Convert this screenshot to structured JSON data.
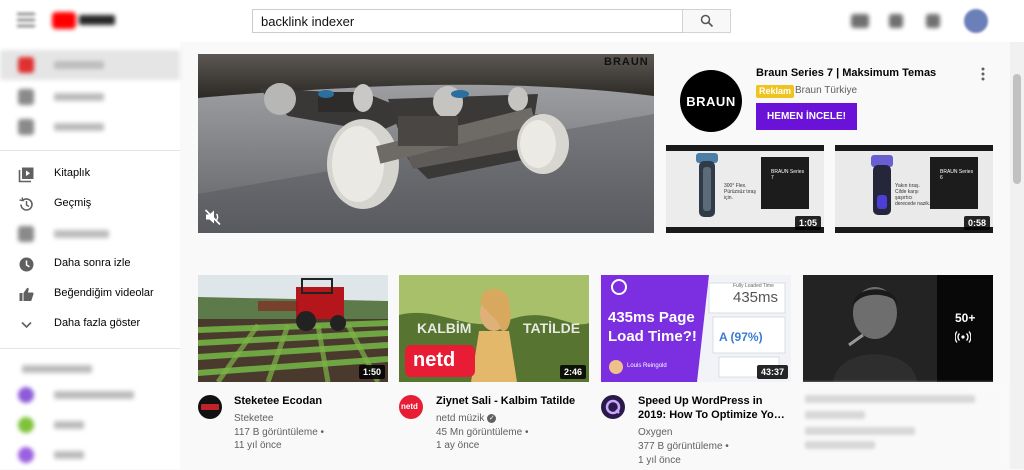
{
  "search": {
    "value": "backlink indexer"
  },
  "sidebar": {
    "items": [
      {
        "label": "Kitaplık",
        "icon": "library-icon"
      },
      {
        "label": "Geçmiş",
        "icon": "history-icon"
      },
      {
        "label": "Daha sonra izle",
        "icon": "watch-later-icon"
      },
      {
        "label": "Beğendiğim videolar",
        "icon": "thumbs-up-icon"
      },
      {
        "label": "Daha fazla göster",
        "icon": "chevron-down-icon"
      }
    ]
  },
  "ad": {
    "badge_text": "BRAUN",
    "logo_text": "BRAUN",
    "title": "Braun Series 7 | Maksimum Temas",
    "badge": "Reklam",
    "channel": "Braun Türkiye",
    "cta": "HEMEN İNCELE!",
    "thumbs": [
      {
        "duration": "1:05",
        "caption": "300° Flex. Pürüzsüz tıraş için.",
        "brand": "BRAUN Series 7"
      },
      {
        "duration": "0:58",
        "caption": "Yakın tıraş. Cilde karşı şaşırtıcı derecede nazik.",
        "brand": "BRAUN Series 6"
      }
    ]
  },
  "videos": [
    {
      "title": "Steketee Ecodan",
      "channel": "Steketee",
      "views": "117 B görüntüleme •",
      "age": "11 yıl önce",
      "duration": "1:50",
      "verified": false
    },
    {
      "title": "Ziynet Sali - Kalbim Tatilde",
      "channel": "netd müzik",
      "views": "45 Mn görüntüleme •",
      "age": "1 ay önce",
      "duration": "2:46",
      "verified": true,
      "thumb_text": "netd",
      "overlay_left": "KALBİM",
      "overlay_right": "TATİLDE",
      "avatar_text": "netd"
    },
    {
      "title": "Speed Up WordPress in 2019: How To Optimize Yo…",
      "channel": "Oxygen",
      "views": "377 B görüntüleme •",
      "age": "1 yıl önce",
      "duration": "43:37",
      "verified": false,
      "thumb_title": "435ms Page Load Time?!",
      "thumb_stat": "435ms",
      "thumb_stat_label": "Fully Loaded Time",
      "thumb_grade": "A (97%)",
      "thumb_author": "Louis Reingold"
    },
    {
      "playlist_count": "50+"
    }
  ],
  "colors": {
    "accent": "#ff0000",
    "cta": "#6a12d8",
    "badge": "#f0c420"
  }
}
